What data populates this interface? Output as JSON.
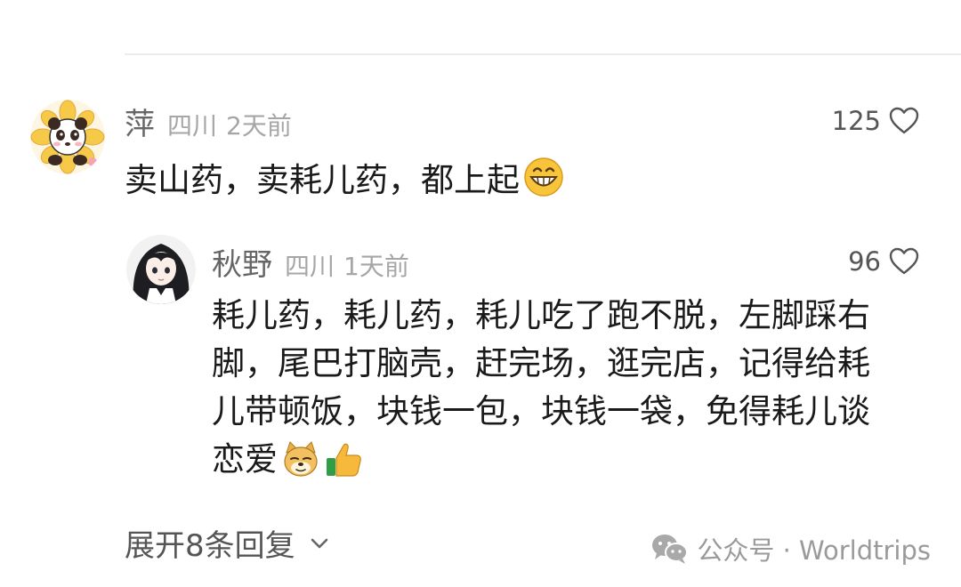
{
  "comment": {
    "username": "萍",
    "location": "四川",
    "time": "2天前",
    "likes": "125",
    "text": "卖山药，卖耗儿药，都上起"
  },
  "reply": {
    "username": "秋野",
    "location": "四川",
    "time": "1天前",
    "likes": "96",
    "lines": [
      "耗儿药，耗儿药，耗儿吃了跑不脱，左脚踩右",
      "脚，尾巴打脑壳，赶完场，逛完店，记得给耗",
      "儿带顿饭，块钱一包，块钱一袋，免得耗儿谈",
      "恋爱"
    ]
  },
  "expand": {
    "label": "展开8条回复"
  },
  "watermark": {
    "text": "公众号 · Worldtrips"
  },
  "colors": {
    "username": "#666666",
    "meta": "#a6a6a6",
    "body_text": "#1a1a1a",
    "emoji_yellow": "#f8c43a",
    "thumbs_green": "#2f9e44"
  }
}
